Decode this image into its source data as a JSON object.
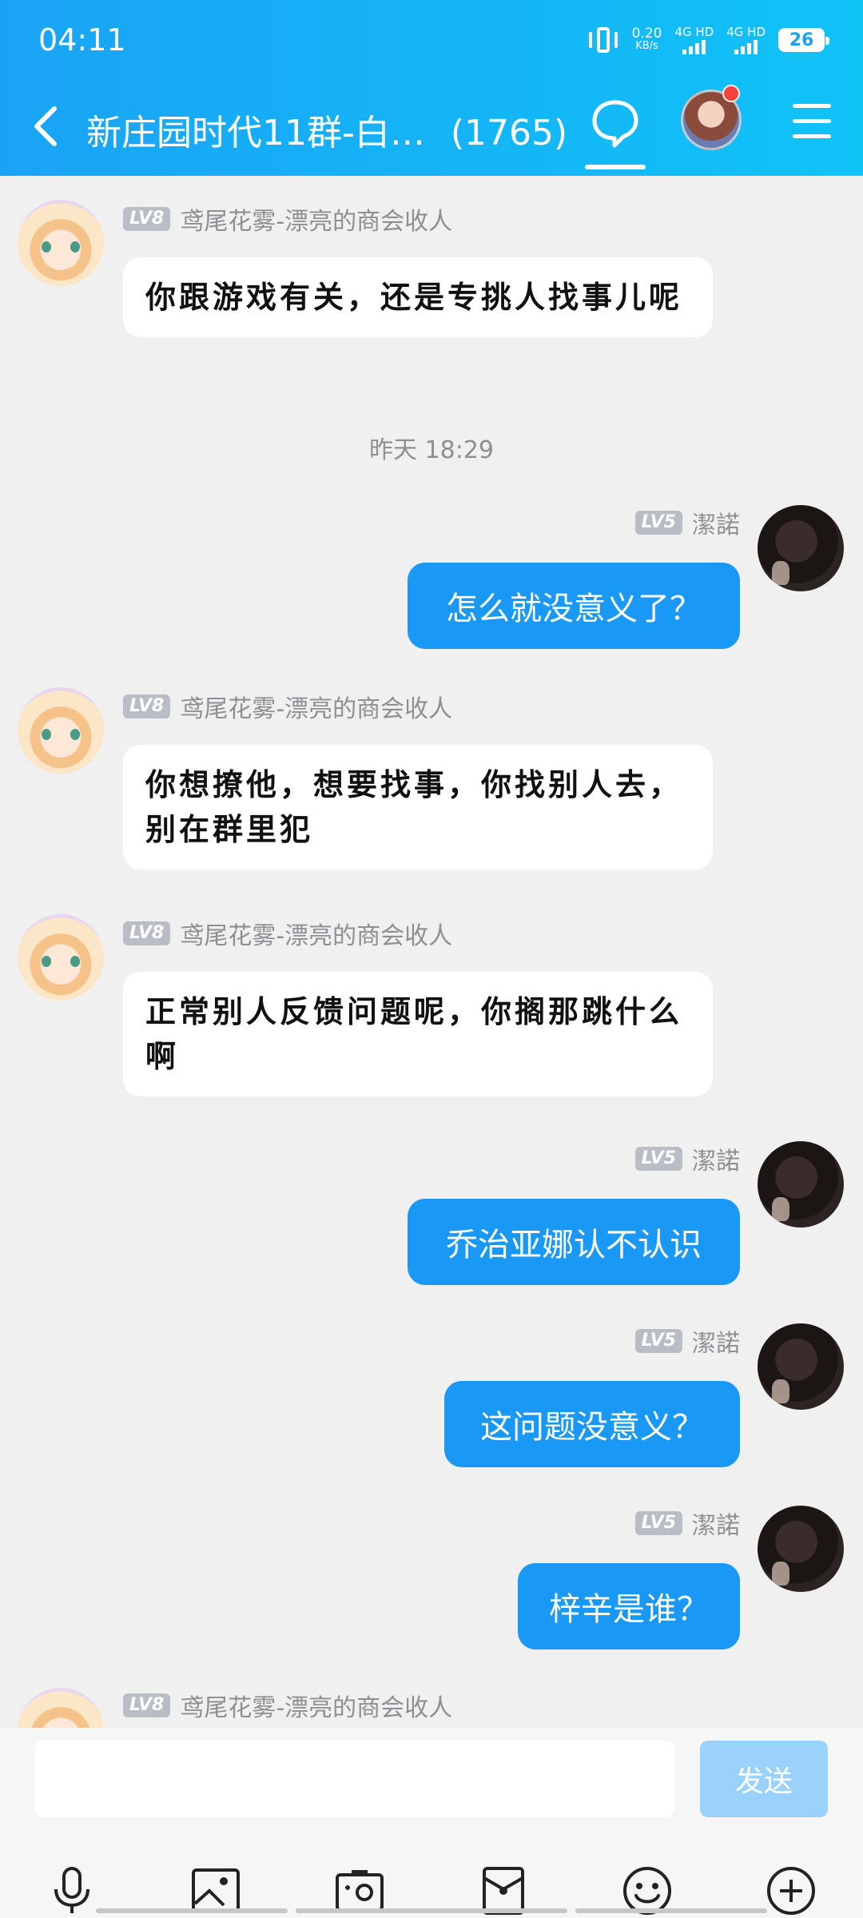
{
  "status_bar": {
    "time": "04:11",
    "net_speed_value": "0.20",
    "net_speed_unit": "KB/s",
    "sim1": "4G HD",
    "sim2": "4G HD",
    "battery": "26"
  },
  "header": {
    "title": "新庄园时代11群-白…",
    "member_count": "(1765)"
  },
  "timestamp": "昨天 18:29",
  "messages": [
    {
      "side": "left",
      "level": "LV8",
      "sender": "鸢尾花雾-漂亮的商会收人",
      "text": "你跟游戏有关，还是专挑人找事儿呢"
    },
    {
      "side": "right",
      "level": "LV5",
      "sender": "潔諾",
      "text": "怎么就没意义了？"
    },
    {
      "side": "left",
      "level": "LV8",
      "sender": "鸢尾花雾-漂亮的商会收人",
      "text": "你想撩他，想要找事，你找别人去，别在群里犯"
    },
    {
      "side": "left",
      "level": "LV8",
      "sender": "鸢尾花雾-漂亮的商会收人",
      "text": "正常别人反馈问题呢，你搁那跳什么啊"
    },
    {
      "side": "right",
      "level": "LV5",
      "sender": "潔諾",
      "text": "乔治亚娜认不认识"
    },
    {
      "side": "right",
      "level": "LV5",
      "sender": "潔諾",
      "text": "这问题没意义？"
    },
    {
      "side": "right",
      "level": "LV5",
      "sender": "潔諾",
      "text": "梓辛是谁？"
    },
    {
      "side": "left",
      "level": "LV8",
      "sender": "鸢尾花雾-漂亮的商会收人",
      "text": ""
    }
  ],
  "input": {
    "placeholder": "",
    "value": "",
    "send_label": "发送"
  },
  "toolbar": [
    "mic-icon",
    "image-icon",
    "camera-icon",
    "red-packet-icon",
    "emoji-icon",
    "plus-icon"
  ],
  "colors": {
    "header": "#1aa3f5",
    "bubble_self": "#1a98f6",
    "send_disabled": "#9ad2fb",
    "background": "#f0f0f0"
  }
}
